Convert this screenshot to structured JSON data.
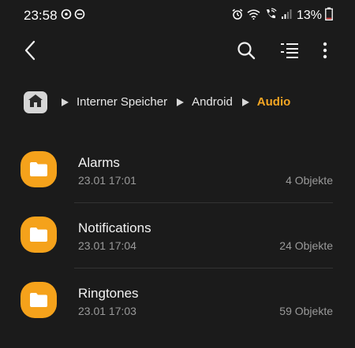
{
  "status_bar": {
    "time": "23:58",
    "battery_percent": "13%",
    "battery_level": 0.13,
    "battery_color": "#e04040"
  },
  "toolbar": {
    "back_icon": "chevron-left-icon",
    "search_icon": "search-icon",
    "list_icon": "list-view-icon",
    "more_icon": "more-vertical-icon"
  },
  "breadcrumb": {
    "home_icon": "home-icon",
    "items": [
      {
        "label": "Interner Speicher"
      },
      {
        "label": "Android"
      },
      {
        "label": "Audio"
      }
    ],
    "accent": "#f5a623"
  },
  "files": [
    {
      "name": "Alarms",
      "date": "23.01 17:01",
      "count": "4 Objekte"
    },
    {
      "name": "Notifications",
      "date": "23.01 17:04",
      "count": "24 Objekte"
    },
    {
      "name": "Ringtones",
      "date": "23.01 17:03",
      "count": "59 Objekte"
    }
  ],
  "folder_color": "#f5a21b"
}
